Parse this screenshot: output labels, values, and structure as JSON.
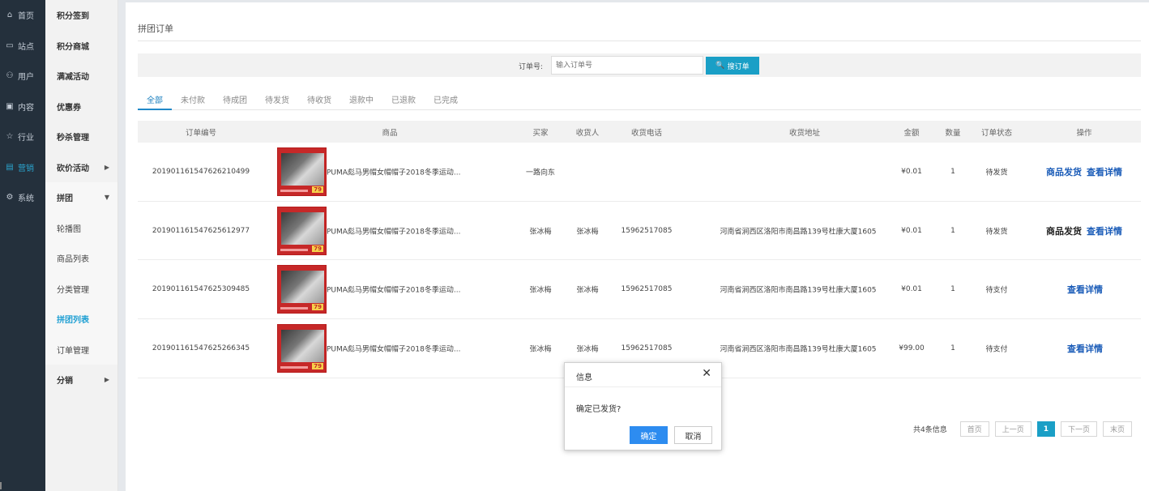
{
  "rail": [
    {
      "icon": "home-icon",
      "glyph": "⌂",
      "label": "首页"
    },
    {
      "icon": "monitor-icon",
      "glyph": "▭",
      "label": "站点"
    },
    {
      "icon": "user-icon",
      "glyph": "⚇",
      "label": "用户"
    },
    {
      "icon": "inbox-icon",
      "glyph": "▣",
      "label": "内容"
    },
    {
      "icon": "star-icon",
      "glyph": "☆",
      "label": "行业"
    },
    {
      "icon": "calendar-icon",
      "glyph": "▤",
      "label": "营销"
    },
    {
      "icon": "settings-icon",
      "glyph": "⚙",
      "label": "系统"
    }
  ],
  "subnav": {
    "items": [
      {
        "label": "积分签到"
      },
      {
        "label": "积分商城"
      },
      {
        "label": "满减活动"
      },
      {
        "label": "优惠券"
      },
      {
        "label": "秒杀管理"
      },
      {
        "label": "砍价活动",
        "arrow": "▶"
      },
      {
        "label": "拼团",
        "arrow": "▼"
      },
      {
        "label": "轮播图"
      },
      {
        "label": "商品列表"
      },
      {
        "label": "分类管理"
      },
      {
        "label": "拼团列表"
      },
      {
        "label": "订单管理"
      },
      {
        "label": "分销",
        "arrow": "▶"
      }
    ]
  },
  "page": {
    "title": "拼团订单"
  },
  "search": {
    "label": "订单号:",
    "placeholder": "输入订单号",
    "button": "搜订单",
    "search_icon": "🔍"
  },
  "tabs": [
    "全部",
    "未付款",
    "待成团",
    "待发货",
    "待收货",
    "退款中",
    "已退款",
    "已完成"
  ],
  "table": {
    "headers": [
      "订单编号",
      "商品",
      "买家",
      "收货人",
      "收货电话",
      "收货地址",
      "金额",
      "数量",
      "订单状态",
      "操作"
    ],
    "rows": [
      {
        "order_no": "201901161547626210499",
        "product": "PUMA彪马男帽女帽帽子2018冬季运动...",
        "buyer": "一路向东",
        "receiver": "",
        "phone": "",
        "address": "",
        "amount": "¥0.01",
        "qty": "1",
        "status": "待发货",
        "ship": "商品发货",
        "detail": "查看详情",
        "price_badge": "79"
      },
      {
        "order_no": "201901161547625612977",
        "product": "PUMA彪马男帽女帽帽子2018冬季运动...",
        "buyer": "张冰梅",
        "receiver": "张冰梅",
        "phone": "15962517085",
        "address": "河南省涧西区洛阳市南昌路139号杜康大厦1605",
        "amount": "¥0.01",
        "qty": "1",
        "status": "待发货",
        "ship": "商品发货",
        "detail": "查看详情",
        "price_badge": "79"
      },
      {
        "order_no": "201901161547625309485",
        "product": "PUMA彪马男帽女帽帽子2018冬季运动...",
        "buyer": "张冰梅",
        "receiver": "张冰梅",
        "phone": "15962517085",
        "address": "河南省涧西区洛阳市南昌路139号杜康大厦1605",
        "amount": "¥0.01",
        "qty": "1",
        "status": "待支付",
        "ship": "",
        "detail": "查看详情",
        "price_badge": "79"
      },
      {
        "order_no": "201901161547625266345",
        "product": "PUMA彪马男帽女帽帽子2018冬季运动...",
        "buyer": "张冰梅",
        "receiver": "张冰梅",
        "phone": "15962517085",
        "address": "河南省涧西区洛阳市南昌路139号杜康大厦1605",
        "amount": "¥99.00",
        "qty": "1",
        "status": "待支付",
        "ship": "",
        "detail": "查看详情",
        "price_badge": "79"
      }
    ]
  },
  "pagination": {
    "info": "共4条信息",
    "first": "首页",
    "prev": "上一页",
    "current": "1",
    "next": "下一页",
    "last": "末页"
  },
  "dialog": {
    "title": "信息",
    "message": "确定已发货?",
    "ok": "确定",
    "cancel": "取消",
    "close_glyph": "✕"
  },
  "colors": {
    "accent": "#1a9fc6",
    "link": "#1b5cb8",
    "rail_bg": "#24303c",
    "rail_active": "#2aa4ce",
    "dialog_ok": "#2d8cf0"
  }
}
